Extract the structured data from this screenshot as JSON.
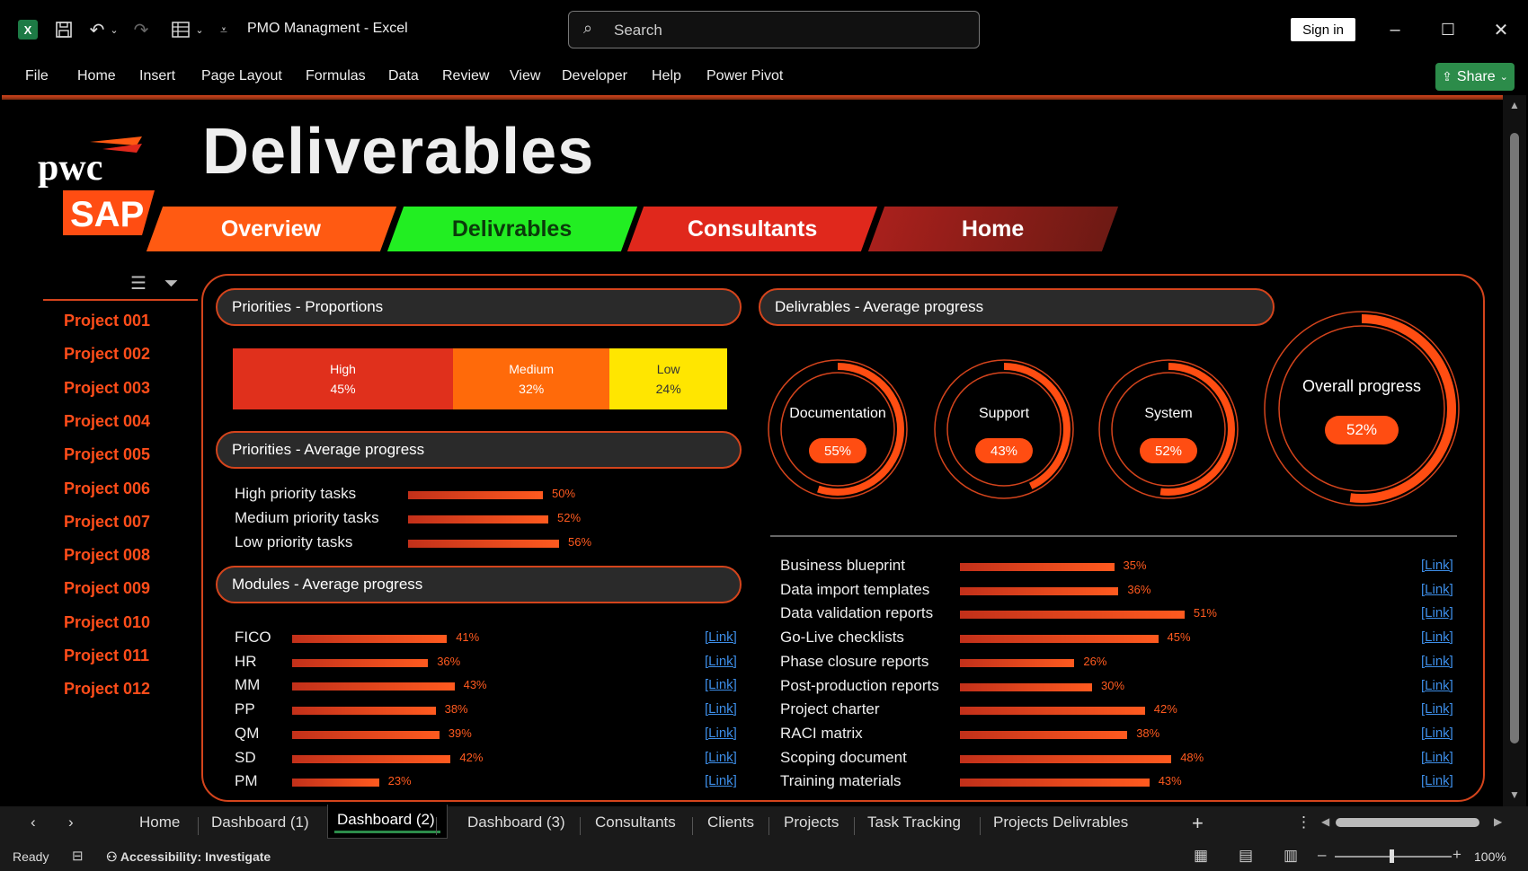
{
  "app": {
    "title": "PMO Managment  -  Excel",
    "search_placeholder": "Search",
    "sign_in": "Sign in",
    "share": "Share"
  },
  "menu": [
    "File",
    "Home",
    "Insert",
    "Page Layout",
    "Formulas",
    "Data",
    "Review",
    "View",
    "Developer",
    "Help",
    "Power Pivot"
  ],
  "dashboard": {
    "title": "Deliverables",
    "logo": {
      "text_top": "pwc",
      "text_bottom": "SAP"
    },
    "nav_tabs": [
      {
        "label": "Overview",
        "color": "#ff5a12",
        "text_color": "#ffffff"
      },
      {
        "label": "Delivrables",
        "color": "#22ee22",
        "text_color": "#0b3b0b"
      },
      {
        "label": "Consultants",
        "color": "#e0281c",
        "text_color": "#ffffff"
      },
      {
        "label": "Home",
        "color": "#a8201c",
        "text_color": "#ffffff"
      }
    ],
    "projects": [
      "Project 001",
      "Project 002",
      "Project 003",
      "Project 004",
      "Project 005",
      "Project 006",
      "Project 007",
      "Project 008",
      "Project 009",
      "Project 010",
      "Project 011",
      "Project 012"
    ],
    "priorities_proportions": {
      "header": "Priorities - Proportions",
      "segments": [
        {
          "label": "High",
          "pct": "45%",
          "value": 45,
          "color": "#e0301c"
        },
        {
          "label": "Medium",
          "pct": "32%",
          "value": 32,
          "color": "#ff6a0a"
        },
        {
          "label": "Low",
          "pct": "24%",
          "value": 24,
          "color": "#ffe600"
        }
      ]
    },
    "priorities_progress": {
      "header": "Priorities - Average progress",
      "items": [
        {
          "label": "High priority tasks",
          "pct": "50%",
          "value": 50
        },
        {
          "label": "Medium priority tasks",
          "pct": "52%",
          "value": 52
        },
        {
          "label": "Low priority tasks",
          "pct": "56%",
          "value": 56
        }
      ]
    },
    "modules_progress": {
      "header": "Modules - Average progress",
      "link_text": "[Link]",
      "items": [
        {
          "label": "FICO",
          "pct": "41%",
          "value": 41
        },
        {
          "label": "HR",
          "pct": "36%",
          "value": 36
        },
        {
          "label": "MM",
          "pct": "43%",
          "value": 43
        },
        {
          "label": "PP",
          "pct": "38%",
          "value": 38
        },
        {
          "label": "QM",
          "pct": "39%",
          "value": 39
        },
        {
          "label": "SD",
          "pct": "42%",
          "value": 42
        },
        {
          "label": "PM",
          "pct": "23%",
          "value": 23
        }
      ]
    },
    "deliverables_progress": {
      "header": "Delivrables - Average progress",
      "donuts": [
        {
          "label": "Documentation",
          "pct": "55%",
          "value": 55
        },
        {
          "label": "Support",
          "pct": "43%",
          "value": 43
        },
        {
          "label": "System",
          "pct": "52%",
          "value": 52
        }
      ],
      "overall": {
        "label": "Overall progress",
        "pct": "52%",
        "value": 52
      },
      "link_text": "[Link]",
      "items": [
        {
          "label": "Business blueprint",
          "pct": "35%",
          "value": 35
        },
        {
          "label": "Data import templates",
          "pct": "36%",
          "value": 36
        },
        {
          "label": "Data validation reports",
          "pct": "51%",
          "value": 51
        },
        {
          "label": "Go-Live checklists",
          "pct": "45%",
          "value": 45
        },
        {
          "label": "Phase closure reports",
          "pct": "26%",
          "value": 26
        },
        {
          "label": "Post-production reports",
          "pct": "30%",
          "value": 30
        },
        {
          "label": "Project charter",
          "pct": "42%",
          "value": 42
        },
        {
          "label": "RACI matrix",
          "pct": "38%",
          "value": 38
        },
        {
          "label": "Scoping document",
          "pct": "48%",
          "value": 48
        },
        {
          "label": "Training materials",
          "pct": "43%",
          "value": 43
        }
      ]
    }
  },
  "sheet_tabs": [
    "Home",
    "Dashboard (1)",
    "Dashboard (2)",
    "Dashboard (3)",
    "Consultants",
    "Clients",
    "Projects",
    "Task Tracking",
    "Projects Delivrables"
  ],
  "status": {
    "ready": "Ready",
    "accessibility": "Accessibility: Investigate",
    "zoom": "100%"
  }
}
